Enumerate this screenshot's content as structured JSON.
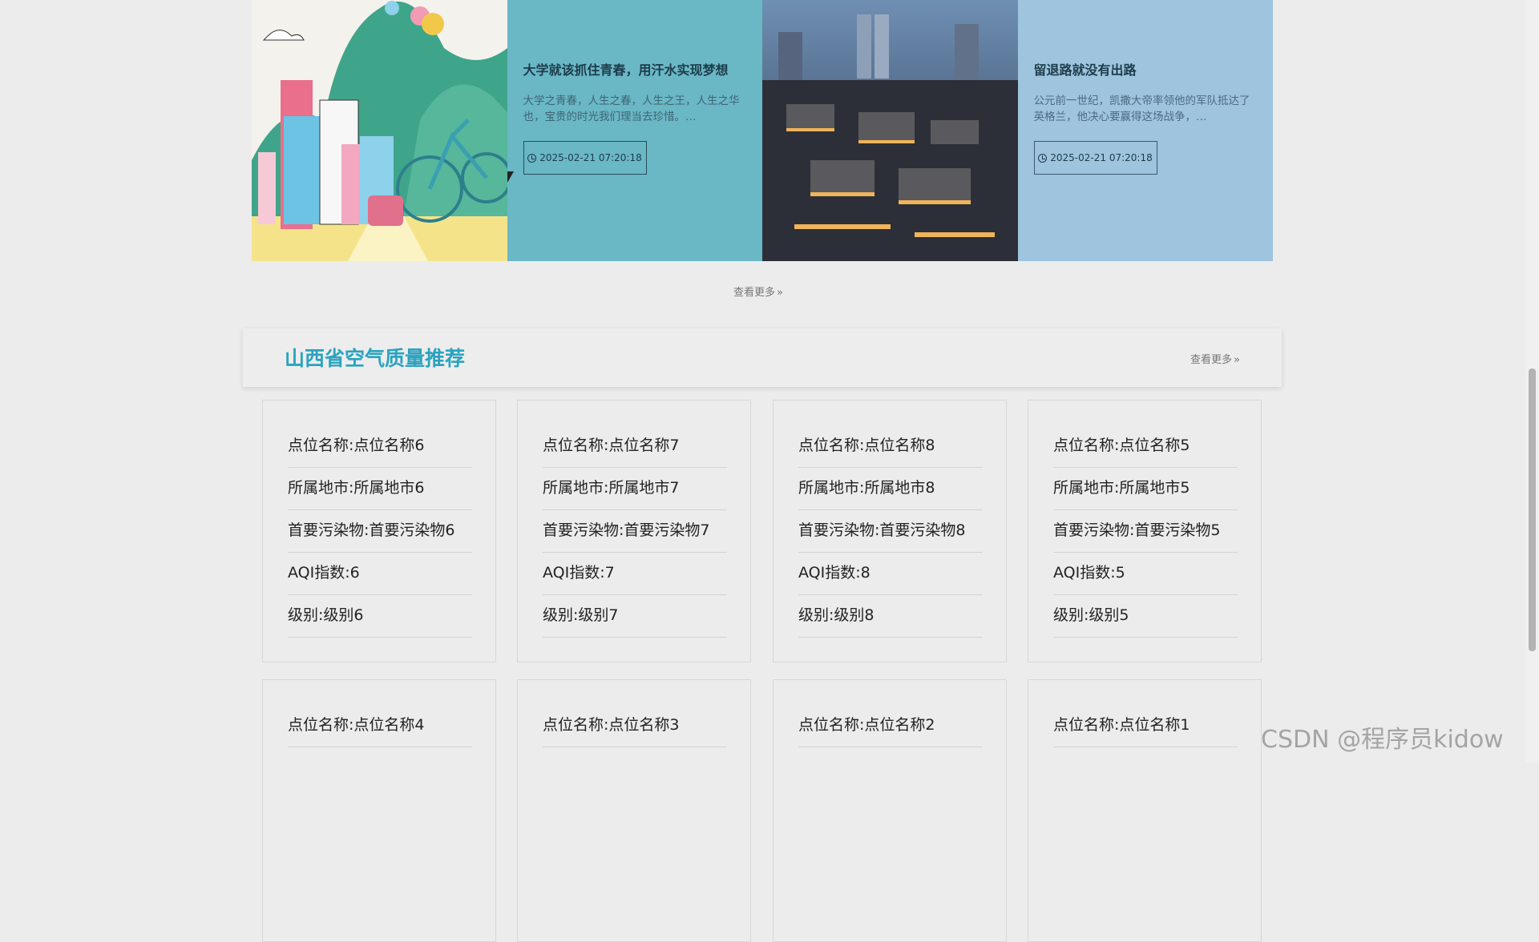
{
  "news": {
    "items": [
      {
        "title": "大学就该抓住青春，用汗水实现梦想",
        "desc": "大学之青春，人生之春，人生之王，人生之华也，宝贵的时光我们理当去珍惜。…",
        "date": "2025-02-21 07:20:18"
      },
      {
        "title": "留退路就没有出路",
        "desc": "公元前一世纪，凯撒大帝率领他的军队抵达了英格兰，他决心要赢得这场战争，…",
        "date": "2025-02-21 07:20:18"
      }
    ],
    "more_label": "查看更多"
  },
  "section": {
    "title": "山西省空气质量推荐",
    "more_label": "查看更多"
  },
  "cards": [
    [
      "点位名称:点位名称6",
      "所属地市:所属地市6",
      "首要污染物:首要污染物6",
      "AQI指数:6",
      "级别:级别6"
    ],
    [
      "点位名称:点位名称7",
      "所属地市:所属地市7",
      "首要污染物:首要污染物7",
      "AQI指数:7",
      "级别:级别7"
    ],
    [
      "点位名称:点位名称8",
      "所属地市:所属地市8",
      "首要污染物:首要污染物8",
      "AQI指数:8",
      "级别:级别8"
    ],
    [
      "点位名称:点位名称5",
      "所属地市:所属地市5",
      "首要污染物:首要污染物5",
      "AQI指数:5",
      "级别:级别5"
    ],
    [
      "点位名称:点位名称4"
    ],
    [
      "点位名称:点位名称3"
    ],
    [
      "点位名称:点位名称2"
    ],
    [
      "点位名称:点位名称1"
    ]
  ],
  "watermark": "CSDN @程序员kidow",
  "colors": {
    "accent": "#2aa3bf",
    "tile_teal": "#6ab7c6",
    "tile_blue": "#9ec4de",
    "background": "#ececec"
  }
}
